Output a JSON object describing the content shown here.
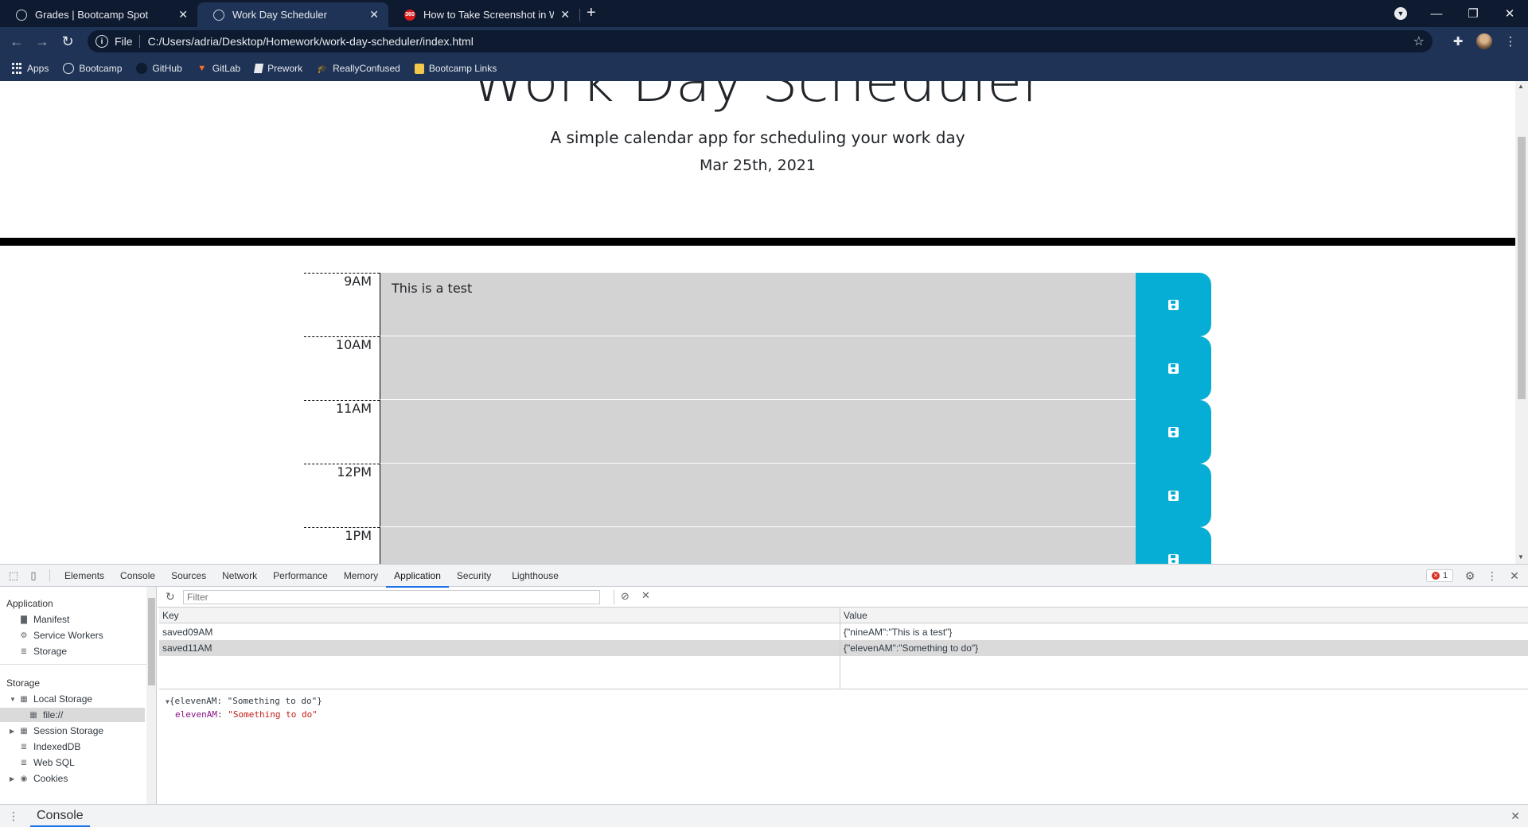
{
  "browser": {
    "tabs": [
      {
        "title": "Grades | Bootcamp Spot",
        "close": "✕"
      },
      {
        "title": "Work Day Scheduler",
        "close": "✕"
      },
      {
        "title": "How to Take Screenshot in Windows",
        "close": "✕"
      }
    ],
    "new_tab": "+",
    "url_scheme": "File",
    "url": "C:/Users/adria/Desktop/Homework/work-day-scheduler/index.html",
    "bookmarks": [
      "Apps",
      "Bootcamp",
      "GitHub",
      "GitLab",
      "Prework",
      "ReallyConfused",
      "Bootcamp Links"
    ]
  },
  "page": {
    "title": "Work Day Scheduler",
    "lead": "A simple calendar app for scheduling your work day",
    "date": "Mar 25th, 2021",
    "rows": [
      {
        "hour": "9AM",
        "text": "This is a test"
      },
      {
        "hour": "10AM",
        "text": ""
      },
      {
        "hour": "11AM",
        "text": ""
      },
      {
        "hour": "12PM",
        "text": ""
      },
      {
        "hour": "1PM",
        "text": ""
      }
    ],
    "colors": {
      "past": "#d3d3d3",
      "save": "#06aed5"
    }
  },
  "devtools": {
    "tabs": [
      "Elements",
      "Console",
      "Sources",
      "Network",
      "Performance",
      "Memory",
      "Application",
      "Security",
      "Lighthouse"
    ],
    "active_tab": "Application",
    "error_count": "1",
    "sidebar": {
      "application_header": "Application",
      "application_items": [
        "Manifest",
        "Service Workers",
        "Storage"
      ],
      "storage_header": "Storage",
      "local_storage": "Local Storage",
      "local_storage_child": "file://",
      "storage_items": [
        "Session Storage",
        "IndexedDB",
        "Web SQL",
        "Cookies"
      ]
    },
    "filter_placeholder": "Filter",
    "table": {
      "key_header": "Key",
      "value_header": "Value",
      "rows": [
        {
          "key": "saved09AM",
          "value": "{\"nineAM\":\"This is a test\"}"
        },
        {
          "key": "saved11AM",
          "value": "{\"elevenAM\":\"Something to do\"}"
        }
      ]
    },
    "preview": {
      "summary": "{elevenAM: \"Something to do\"}",
      "prop_key": "elevenAM",
      "prop_value": "\"Something to do\""
    },
    "drawer_tab": "Console"
  }
}
